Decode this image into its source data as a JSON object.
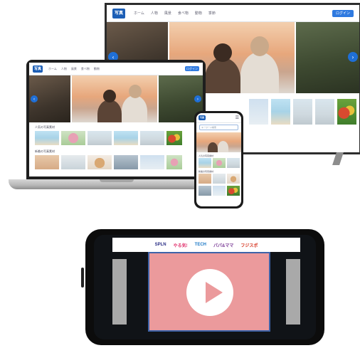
{
  "site": {
    "logo": "写真",
    "nav_links": [
      "ホーム",
      "人物",
      "風景",
      "食べ物",
      "動物",
      "季節"
    ],
    "cta": "ログイン",
    "search_placeholder": "キーワード検索"
  },
  "sections": {
    "popular": "人気の写真素材",
    "new": "新着の写真素材"
  },
  "video_tabs": [
    {
      "label": "SPLN",
      "color": "#2b2f86"
    },
    {
      "label": "やる気!",
      "color": "#e23a73"
    },
    {
      "label": "TECH",
      "color": "#1d79c6"
    },
    {
      "label": "パパ&ママ",
      "color": "#7a3b96"
    },
    {
      "label": "フジスポ",
      "color": "#d6331e"
    }
  ],
  "icons": {
    "prev": "chevron-left",
    "next": "chevron-right",
    "play": "play-triangle"
  },
  "colors": {
    "brand": "#1d5fb6",
    "video_panel": "#eb9a9c"
  }
}
